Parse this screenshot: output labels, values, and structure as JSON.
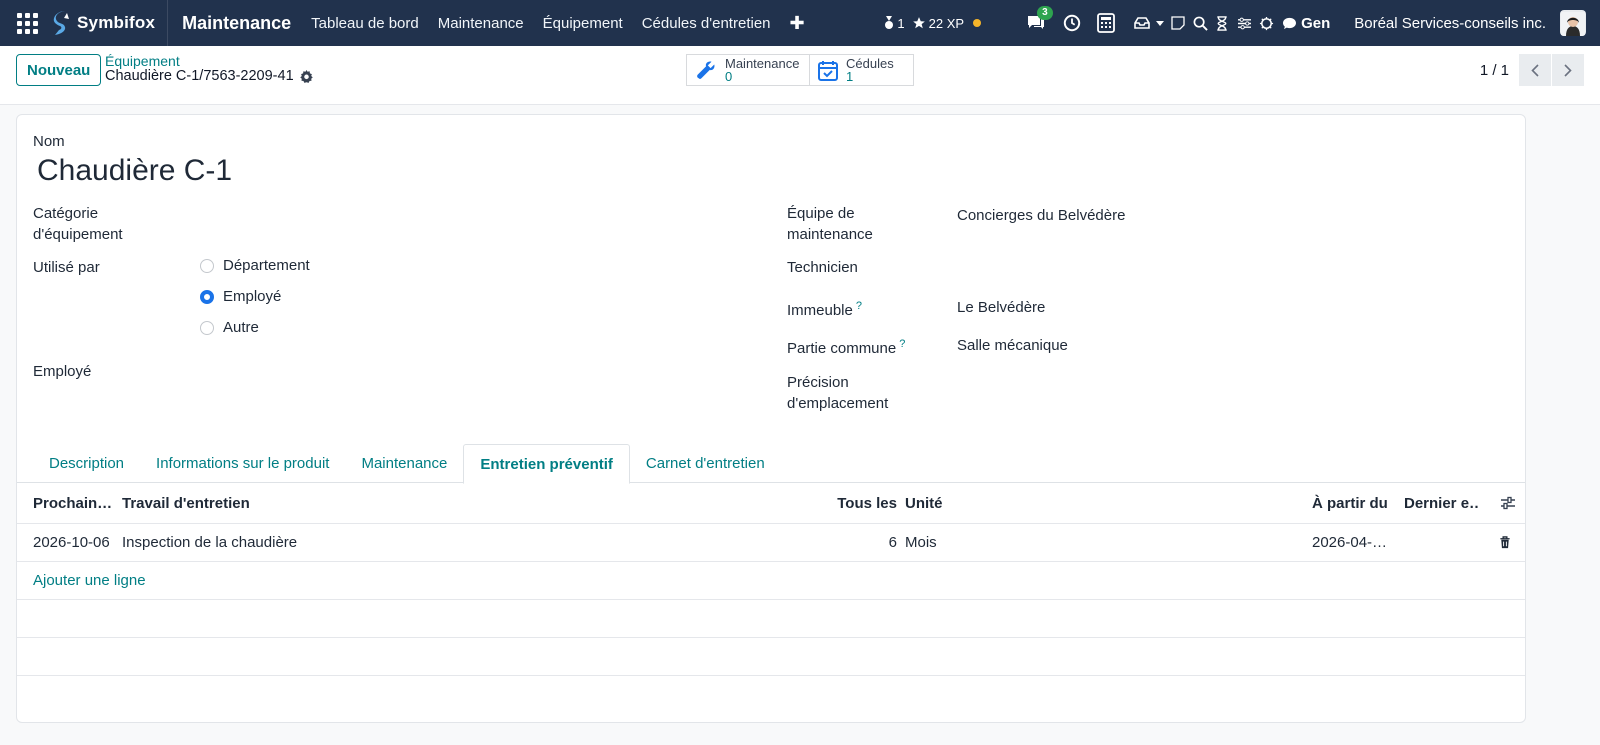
{
  "navbar": {
    "brand": "Symbifox",
    "app_title": "Maintenance",
    "menu": [
      "Tableau de bord",
      "Maintenance",
      "Équipement",
      "Cédules d'entretien"
    ],
    "menu_add": "✚",
    "stat_count": "1",
    "xp": "22 XP",
    "chat_badge": "3",
    "gen_label": "Gen",
    "company": "Boréal Services-conseils inc."
  },
  "control_panel": {
    "new_button": "Nouveau",
    "breadcrumb_parent": "Équipement",
    "breadcrumb_current": "Chaudière C-1/7563-2209-41",
    "smart_buttons": [
      {
        "label": "Maintenance",
        "count": "0",
        "icon": "wrench-icon"
      },
      {
        "label": "Cédules",
        "count": "1",
        "icon": "calendar-check-icon"
      }
    ],
    "pager": "1 / 1"
  },
  "form": {
    "name_label": "Nom",
    "name_value": "Chaudière C-1",
    "category_label_1": "Catégorie",
    "category_label_2": "d'équipement",
    "used_by_label": "Utilisé par",
    "used_by_options": [
      "Département",
      "Employé",
      "Autre"
    ],
    "used_by_selected": "Employé",
    "employee_label": "Employé",
    "team_label_1": "Équipe de",
    "team_label_2": "maintenance",
    "team_value": "Concierges du Belvédère",
    "technician_label": "Technicien",
    "building_label": "Immeuble",
    "building_value": "Le Belvédère",
    "common_area_label": "Partie commune",
    "common_area_value": "Salle mécanique",
    "location_label_1": "Précision",
    "location_label_2": "d'emplacement",
    "help_mark": "?"
  },
  "tabs": [
    "Description",
    "Informations sur le produit",
    "Maintenance",
    "Entretien préventif",
    "Carnet d'entretien"
  ],
  "active_tab": "Entretien préventif",
  "table": {
    "headers": [
      "Prochain…",
      "Travail d'entretien",
      "Tous les",
      "Unité",
      "À partir du",
      "Dernier e…"
    ],
    "rows": [
      {
        "next": "2026-10-06",
        "work": "Inspection de la chaudière",
        "every": "6",
        "unit": "Mois",
        "from": "2026-04-…",
        "last": ""
      }
    ],
    "add_line": "Ajouter une ligne"
  },
  "colors": {
    "navbar": "#21324d",
    "accent": "#017e84",
    "radio_checked": "#1a73e8",
    "badge": "#2ea44f"
  }
}
